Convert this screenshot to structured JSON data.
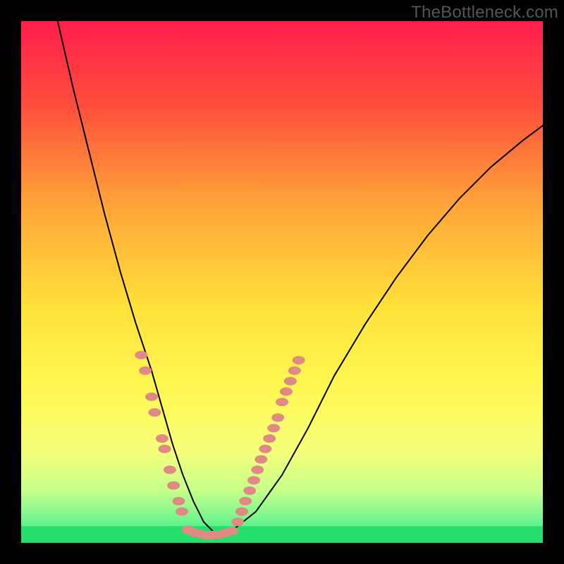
{
  "watermark": "TheBottleneck.com",
  "chart_data": {
    "type": "line",
    "title": "",
    "xlabel": "",
    "ylabel": "",
    "xlim": [
      0,
      100
    ],
    "ylim": [
      0,
      100
    ],
    "gradient_stops": [
      {
        "offset": 0,
        "color": "#ff1f4c"
      },
      {
        "offset": 0.15,
        "color": "#ff4a3c"
      },
      {
        "offset": 0.35,
        "color": "#ffa438"
      },
      {
        "offset": 0.55,
        "color": "#ffe23a"
      },
      {
        "offset": 0.72,
        "color": "#fff955"
      },
      {
        "offset": 0.82,
        "color": "#f7ff7a"
      },
      {
        "offset": 0.9,
        "color": "#c6ff8a"
      },
      {
        "offset": 0.96,
        "color": "#6cf58e"
      },
      {
        "offset": 1.0,
        "color": "#24e06a"
      }
    ],
    "series": [
      {
        "name": "bottleneck-curve",
        "x": [
          7,
          10,
          13,
          16,
          19,
          22,
          25,
          27,
          29,
          31,
          33,
          35,
          37,
          40,
          45,
          50,
          55,
          60,
          66,
          72,
          78,
          84,
          90,
          96,
          100
        ],
        "y": [
          100,
          87,
          75,
          63,
          52,
          42,
          33,
          26,
          19,
          13,
          8,
          4,
          2,
          2,
          6,
          13,
          22,
          32,
          42,
          51,
          59,
          66,
          72,
          77,
          80
        ]
      }
    ],
    "scatter_clusters": [
      {
        "name": "left-descent-dots",
        "color": "#e08a86",
        "points": [
          {
            "x": 23.0,
            "y": 36
          },
          {
            "x": 23.8,
            "y": 33
          },
          {
            "x": 25.0,
            "y": 28
          },
          {
            "x": 25.6,
            "y": 25
          },
          {
            "x": 27.0,
            "y": 20
          },
          {
            "x": 27.5,
            "y": 18
          },
          {
            "x": 28.5,
            "y": 14
          },
          {
            "x": 29.2,
            "y": 11
          },
          {
            "x": 30.2,
            "y": 8
          },
          {
            "x": 30.8,
            "y": 6
          }
        ]
      },
      {
        "name": "trough-dots",
        "color": "#e08a86",
        "points": [
          {
            "x": 32.0,
            "y": 2.5
          },
          {
            "x": 33.2,
            "y": 2.0
          },
          {
            "x": 34.4,
            "y": 1.7
          },
          {
            "x": 35.6,
            "y": 1.5
          },
          {
            "x": 36.8,
            "y": 1.5
          },
          {
            "x": 38.0,
            "y": 1.6
          },
          {
            "x": 39.2,
            "y": 1.9
          },
          {
            "x": 40.4,
            "y": 2.3
          }
        ]
      },
      {
        "name": "right-ascent-dots",
        "color": "#e08a86",
        "points": [
          {
            "x": 41.5,
            "y": 4
          },
          {
            "x": 42.3,
            "y": 6
          },
          {
            "x": 43.0,
            "y": 8
          },
          {
            "x": 43.8,
            "y": 10
          },
          {
            "x": 44.6,
            "y": 12
          },
          {
            "x": 45.3,
            "y": 14
          },
          {
            "x": 46.0,
            "y": 16
          },
          {
            "x": 46.8,
            "y": 18
          },
          {
            "x": 47.6,
            "y": 20
          },
          {
            "x": 48.4,
            "y": 22
          },
          {
            "x": 49.2,
            "y": 24
          },
          {
            "x": 50.0,
            "y": 27
          },
          {
            "x": 50.8,
            "y": 29
          },
          {
            "x": 51.6,
            "y": 31
          },
          {
            "x": 52.4,
            "y": 33
          },
          {
            "x": 53.2,
            "y": 35
          }
        ]
      }
    ],
    "bottom_band": {
      "y_top": 3.2,
      "y_bottom": 0,
      "color": "#24e06a"
    }
  }
}
